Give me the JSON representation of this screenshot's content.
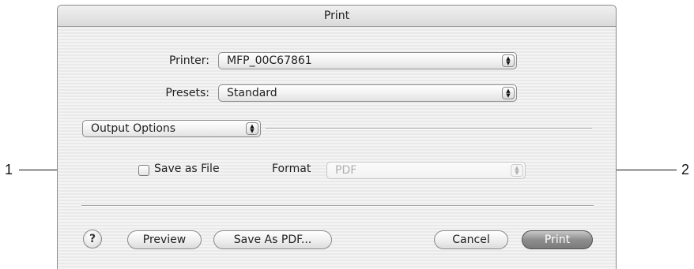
{
  "dialog": {
    "title": "Print",
    "printer": {
      "label": "Printer:",
      "value": "MFP_00C67861"
    },
    "presets": {
      "label": "Presets:",
      "value": "Standard"
    },
    "pane_selector": {
      "value": "Output Options"
    },
    "save_as_file": {
      "label": "Save as File",
      "checked": false
    },
    "format": {
      "label": "Format",
      "value": "PDF",
      "enabled": false
    },
    "buttons": {
      "help": "?",
      "preview": "Preview",
      "save_as_pdf": "Save As PDF...",
      "cancel": "Cancel",
      "print": "Print"
    },
    "icons": {
      "popup_arrows": "up-down-arrows-icon",
      "help": "question-mark-icon"
    }
  },
  "callouts": {
    "one": "1",
    "two": "2"
  },
  "colors": {
    "default_button": "#7a7a7a",
    "dialog_stripe_light": "#f4f4f4",
    "dialog_stripe_dark": "#e9e9e9"
  }
}
